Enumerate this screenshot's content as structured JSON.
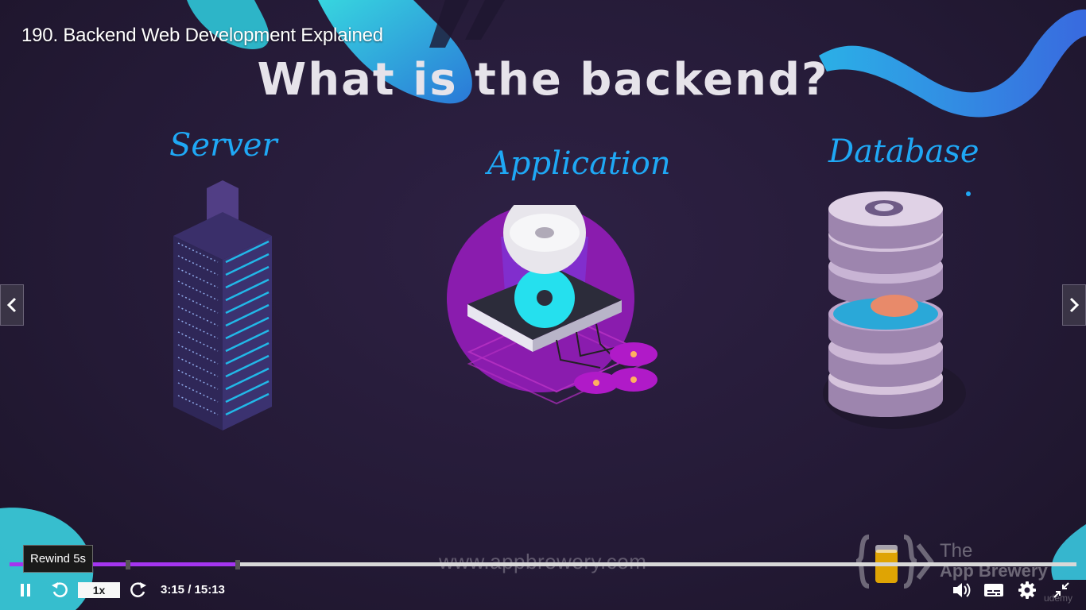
{
  "video": {
    "title": "190. Backend Web Development Explained"
  },
  "slide": {
    "heading": "What is the backend?",
    "labels": {
      "server": "Server",
      "application": "Application",
      "database": "Database"
    },
    "watermark_url": "www.appbrewery.com",
    "brand_line1": "The",
    "brand_line2": "App Brewery",
    "platform_mark": "udemy"
  },
  "player": {
    "tooltip": "Rewind 5s",
    "speed_label": "1x",
    "time_display": "3:15 / 15:13",
    "progress_fraction": 0.214,
    "accent_color": "#a435f0"
  },
  "icons": {
    "prev": "chevron-left-icon",
    "next": "chevron-right-icon",
    "pause": "pause-icon",
    "rewind": "rewind-5s-icon",
    "forward": "forward-5s-icon",
    "volume": "volume-icon",
    "captions": "captions-icon",
    "settings": "gear-icon",
    "exit_fullscreen": "exit-fullscreen-icon"
  }
}
